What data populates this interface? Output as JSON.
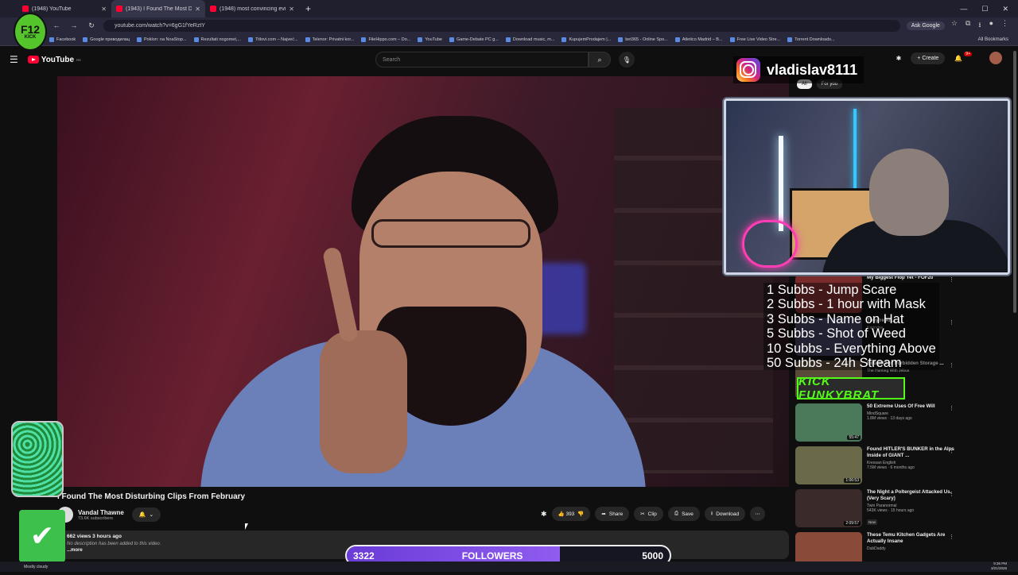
{
  "browser": {
    "tabs": [
      {
        "title": "(1948) YouTube",
        "active": false
      },
      {
        "title": "(1943) I Found The Most D",
        "active": true
      },
      {
        "title": "(1948) most convincing eviden",
        "active": false
      }
    ],
    "url": "youtube.com/watch?v=6gG1fYeRztY",
    "ask_google": "Ask Google",
    "bookmarks": [
      "Facebook",
      "Google преводилац",
      "Poklon: na NoaStop...",
      "Rezultati nogomet,...",
      "Titlovi.com – Najveć...",
      "Telenor: Privatni kor...",
      "FileHippo.com – Do...",
      "YouTube",
      "Game-Debate PC g...",
      "Download music, m...",
      "KupujemProdajem |...",
      "bet365 - Online Spo...",
      "Atletico Madrid – B...",
      "Free Live Video Stre...",
      "Torrent Downloads..."
    ],
    "all_bookmarks": "All Bookmarks"
  },
  "youtube": {
    "logo_text": "YouTube",
    "logo_sup": "RS",
    "search_placeholder": "Search",
    "create_label": "Create",
    "notif_count": "9+",
    "chips": [
      "All",
      "For you"
    ],
    "video": {
      "title": "I Found The Most Disturbing Clips From February",
      "channel": "Vandal Thawne",
      "subscribers": "73.6K subscribers",
      "likes": "393",
      "share": "Share",
      "clip": "Clip",
      "save": "Save",
      "download": "Download",
      "views_meta": "662 views  3 hours ago",
      "description": "No description has been added to this video.",
      "more": "...more"
    },
    "recommendations": [
      {
        "title": "My Biggest Flop Yet - FOF20",
        "channel": "",
        "views": "",
        "duration": "",
        "color": "#7a2c2c"
      },
      {
        "title": "They're All...",
        "channel": "Kartridge",
        "views": "",
        "duration": "",
        "color": "#3c3c5a"
      },
      {
        "title": "Bought His Forbidden Storage ...",
        "channel": "The Hunting With Jebus",
        "views": "",
        "duration": "",
        "color": "#5a4a3a"
      },
      {
        "title": "50 Extreme Uses Of Free Will",
        "channel": "MindSquare",
        "views": "1.8M views · 13 days ago",
        "duration": "55:47",
        "color": "#4a7a5a"
      },
      {
        "title": "Found HITLER'S BUNKER in the Alps Inside of GIANT ...",
        "channel": "Kreosan English",
        "views": "7.5M views · 6 months ago",
        "duration": "1:06:53",
        "color": "#6a6a4a"
      },
      {
        "title": "The Night a Poltergeist Attacked Us. (Very Scary)",
        "channel": "Twin Paranormal",
        "views": "543K views · 15 hours ago",
        "duration": "2:09:57",
        "color": "#3a2a2a",
        "new": "New"
      },
      {
        "title": "These Temu Kitchen Gadgets Are Actually Insane",
        "channel": "DubDaddy",
        "views": "",
        "duration": "",
        "color": "#8a4a3a"
      }
    ]
  },
  "overlay": {
    "instagram_handle": "vladislav8111",
    "sub_goals": [
      "1 Subbs - Jump Scare",
      "2 Subbs - 1 hour with Mask",
      "3 Subbs - Name on Hat",
      "5 Subbs - Shot of Weed",
      "10 Subbs - Everything Above",
      "50 Subbs - 24h Stream"
    ],
    "kick_name": "KICK FUNKYBRAT",
    "f12_logo": "F12",
    "f12_sub": "KICK",
    "followers": {
      "current": "3322",
      "label": "FOLLOWERS",
      "target": "5000",
      "progress": 0.66
    }
  },
  "taskbar": {
    "weather": "Mostly cloudy",
    "time": "9:36 PM",
    "date": "3/21/2026"
  }
}
